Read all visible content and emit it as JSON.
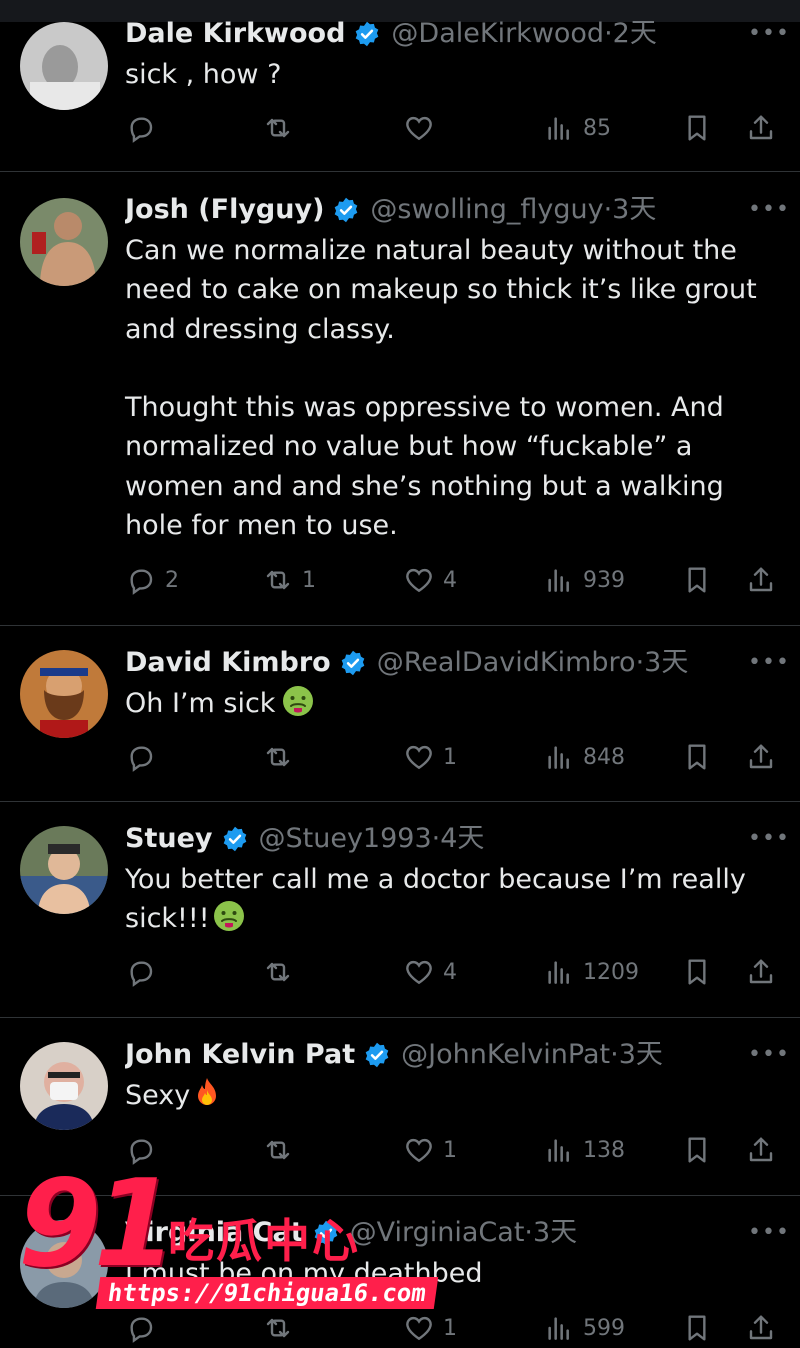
{
  "tweets": [
    {
      "name": "Dale Kirkwood",
      "handle": "@DaleKirkwood",
      "time": "·2天",
      "text": "sick , how ?",
      "replies": "",
      "retweets": "",
      "likes": "",
      "views": "85"
    },
    {
      "name": "Josh (Flyguy)",
      "handle": "@swolling_flyguy",
      "time": "·3天",
      "text": "Can we normalize natural beauty without the\nneed to cake on makeup so thick it’s like grout\nand dressing classy.\n\nThought this was oppressive to women. And\nnormalized no value but how “fuckable” a\nwomen and and she’s nothing but a walking\nhole for men to use.",
      "replies": "2",
      "retweets": "1",
      "likes": "4",
      "views": "939"
    },
    {
      "name": "David Kimbro",
      "handle": "@RealDavidKimbro",
      "time": "·3天",
      "text": "Oh I’m sick",
      "replies": "",
      "retweets": "",
      "likes": "1",
      "views": "848"
    },
    {
      "name": "Stuey",
      "handle": "@Stuey1993",
      "time": "·4天",
      "text": "You better call me a doctor because I’m really\nsick!!!",
      "replies": "",
      "retweets": "",
      "likes": "4",
      "views": "1209"
    },
    {
      "name": "John Kelvin Pat",
      "handle": "@JohnKelvinPat",
      "time": "·3天",
      "text": "Sexy",
      "replies": "",
      "retweets": "",
      "likes": "1",
      "views": "138"
    },
    {
      "name": "Virginia Cat",
      "handle": "@VirginiaCat",
      "time": "·3天",
      "text": "I must be on my deathbed",
      "replies": "",
      "retweets": "",
      "likes": "1",
      "views": "599"
    }
  ],
  "watermark": {
    "number": "91",
    "chinese": "吃瓜中心",
    "url": "https://91chigua16.com"
  },
  "more_glyph": "•••",
  "colors": {
    "background": "#000000",
    "text": "#e7e9ea",
    "muted": "#71767b",
    "verified": "#1d9bf0",
    "divider": "#2f3336",
    "watermark": "#ff1f4b"
  },
  "icons": [
    "reply-icon",
    "retweet-icon",
    "like-icon",
    "views-icon",
    "bookmark-icon",
    "share-icon",
    "verified-badge-icon",
    "more-icon",
    "sick-face-emoji",
    "fire-emoji"
  ]
}
